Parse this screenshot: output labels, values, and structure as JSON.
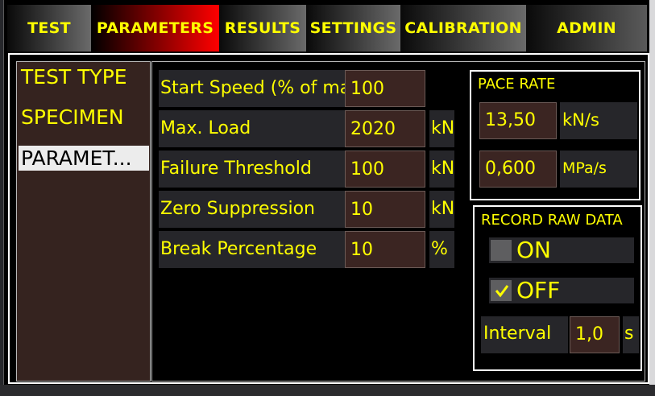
{
  "tabs": [
    {
      "label": "TEST"
    },
    {
      "label": "PARAMETERS"
    },
    {
      "label": "RESULTS"
    },
    {
      "label": "SETTINGS"
    },
    {
      "label": "CALIBRATION"
    },
    {
      "label": "ADMIN"
    }
  ],
  "active_tab": "PARAMETERS",
  "nav": {
    "items": [
      {
        "label": "TEST TYPE"
      },
      {
        "label": "SPECIMEN"
      },
      {
        "label": "PARAMET..."
      }
    ],
    "selected": "PARAMET..."
  },
  "parameters": [
    {
      "label": "Start Speed (% of max",
      "value": "100",
      "unit": ""
    },
    {
      "label": "Max. Load",
      "value": "2020",
      "unit": "kN"
    },
    {
      "label": "Failure Threshold",
      "value": "100",
      "unit": "kN"
    },
    {
      "label": "Zero Suppression",
      "value": "10",
      "unit": "kN"
    },
    {
      "label": "Break Percentage",
      "value": "10",
      "unit": "%"
    }
  ],
  "pace_rate": {
    "title": "PACE RATE",
    "load_value": "13,50",
    "load_unit": "kN/s",
    "stress_value": "0,600",
    "stress_unit": "MPa/s"
  },
  "record_raw_data": {
    "title": "RECORD RAW DATA",
    "on_label": "ON",
    "off_label": "OFF",
    "selected": "OFF",
    "interval_label": "Interval",
    "interval_value": "1,0",
    "interval_unit": "s"
  },
  "colors": {
    "text": "#ffff00",
    "field_bg": "#3b2522",
    "label_bg": "#26262a",
    "active_tab": "#ff0000"
  }
}
